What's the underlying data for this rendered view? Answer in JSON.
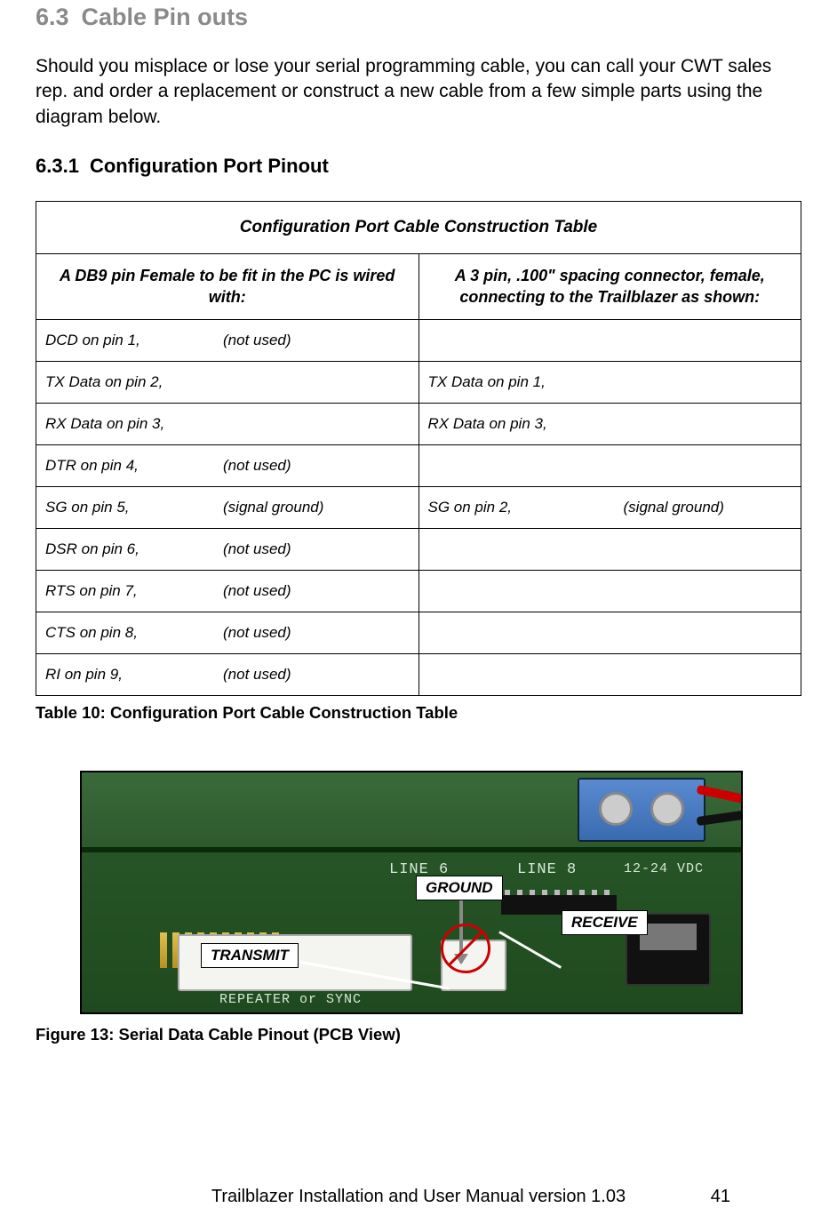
{
  "section": {
    "number": "6.3",
    "title": "Cable Pin outs"
  },
  "intro": "Should you misplace or lose your serial programming cable, you can call your CWT sales rep. and order a replacement or construct a new cable from a few simple parts using the diagram below.",
  "subsection": {
    "number": "6.3.1",
    "title": "Configuration Port Pinout"
  },
  "table": {
    "title": "Configuration Port Cable Construction Table",
    "col_left_header": "A DB9 pin Female to be fit in the PC is wired with:",
    "col_right_header": "A 3 pin, .100\" spacing connector, female, connecting to the Trailblazer as shown:",
    "rows": [
      {
        "left_main": "DCD on pin 1,",
        "left_note": "(not used)",
        "right_main": "",
        "right_note": ""
      },
      {
        "left_main": "TX Data on pin 2,",
        "left_note": "",
        "right_main": "TX Data on pin 1,",
        "right_note": ""
      },
      {
        "left_main": "RX Data on pin 3,",
        "left_note": "",
        "right_main": "RX Data on pin 3,",
        "right_note": ""
      },
      {
        "left_main": "DTR on pin 4,",
        "left_note": "(not used)",
        "right_main": "",
        "right_note": ""
      },
      {
        "left_main": "SG on pin 5,",
        "left_note": "(signal ground)",
        "right_main": "SG on pin 2,",
        "right_note": "(signal ground)"
      },
      {
        "left_main": "DSR on pin 6,",
        "left_note": "(not used)",
        "right_main": "",
        "right_note": ""
      },
      {
        "left_main": "RTS on pin 7,",
        "left_note": "(not used)",
        "right_main": "",
        "right_note": ""
      },
      {
        "left_main": "CTS on pin 8,",
        "left_note": "(not used)",
        "right_main": "",
        "right_note": ""
      },
      {
        "left_main": "RI on pin 9,",
        "left_note": "(not used)",
        "right_main": "",
        "right_note": ""
      }
    ],
    "caption": "Table 10: Configuration Port Cable Construction Table"
  },
  "figure": {
    "labels": {
      "ground": "GROUND",
      "receive": "RECEIVE",
      "transmit": "TRANSMIT"
    },
    "silk": {
      "s1": "",
      "s2": "LINE 6",
      "s3": "LINE 8",
      "s4": "12-24 VDC",
      "s5": "REPEATER or SYNC"
    },
    "caption": "Figure 13: Serial Data Cable Pinout (PCB View)"
  },
  "footer": {
    "text": "Trailblazer Installation and User Manual version 1.03",
    "page": "41"
  }
}
